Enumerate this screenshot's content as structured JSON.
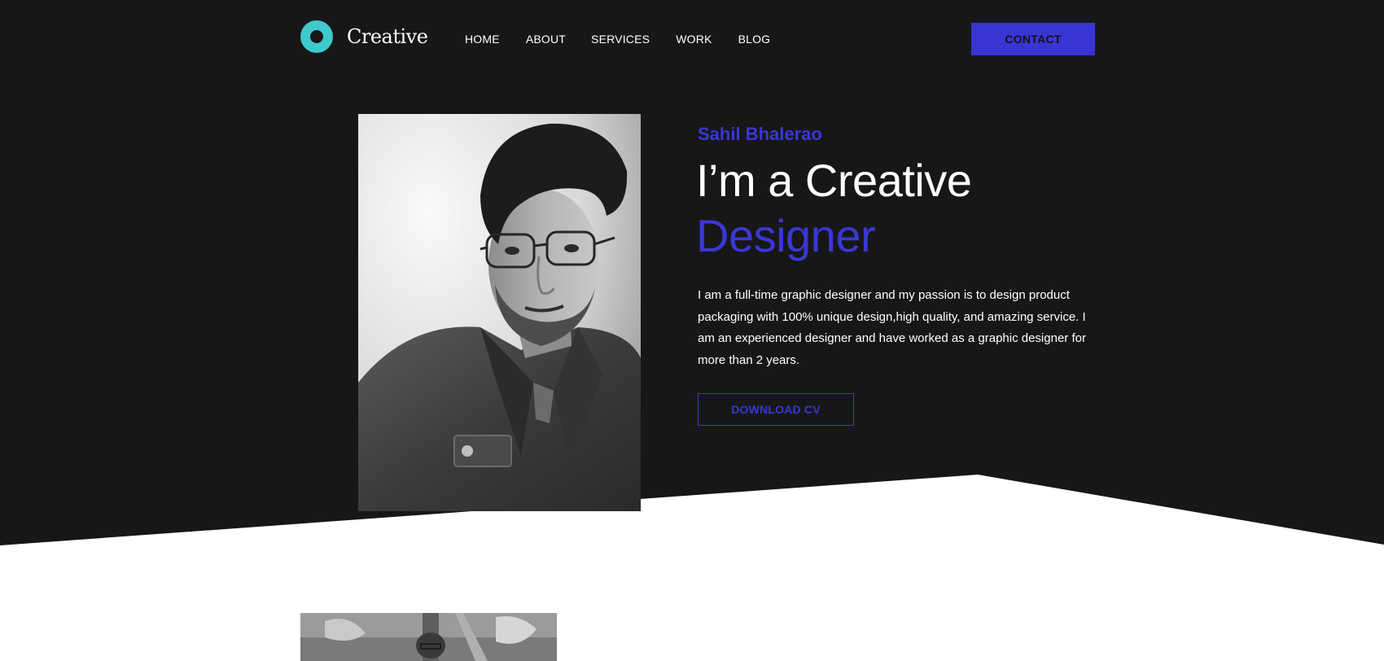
{
  "colors": {
    "background_dark": "#171718",
    "accent": "#3a37d4",
    "logo": "#3ec9cc",
    "text_light": "#ffffff",
    "section_light": "#ffffff"
  },
  "header": {
    "logo_icon": "ring-logo-icon",
    "logo_text": "Creative",
    "nav": [
      {
        "label": "HOME"
      },
      {
        "label": "ABOUT"
      },
      {
        "label": "SERVICES"
      },
      {
        "label": "WORK"
      },
      {
        "label": "BLOG"
      }
    ],
    "contact_label": "CONTACT"
  },
  "hero": {
    "name": "Sahil Bhalerao",
    "title_line1": "I’m a Creative",
    "title_line2": "Designer",
    "description": "I am a full-time graphic designer and my passion is to design product packaging with 100% unique design,high quality, and amazing service. I am an experienced designer and have worked as a graphic designer for more than 2 years.",
    "download_label": "DOWNLOAD CV"
  }
}
